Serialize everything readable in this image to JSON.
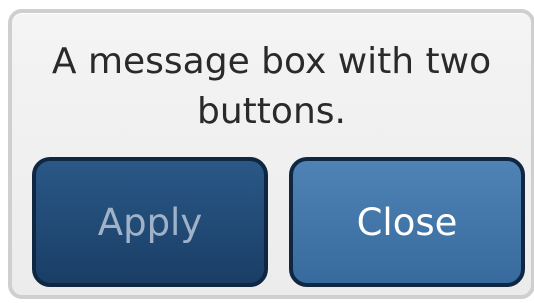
{
  "dialog": {
    "message": "A message box with two\nbuttons.",
    "buttons": {
      "apply_label": "Apply",
      "close_label": "Close"
    }
  },
  "colors": {
    "apply_background": "#1f4a76",
    "apply_text": "#9fb2c8",
    "close_background": "#3f74a8",
    "close_text": "#ffffff",
    "dialog_background": "#efefef"
  }
}
